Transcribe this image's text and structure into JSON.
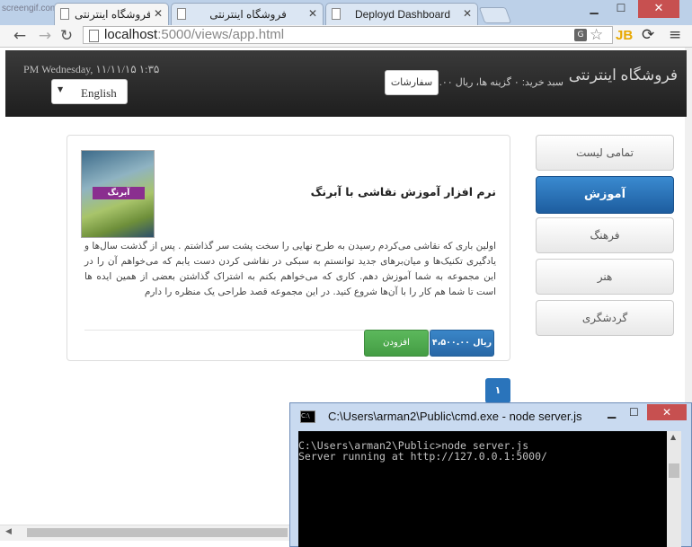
{
  "watermark": "screengif.com",
  "browser": {
    "tabs": [
      {
        "title": "فروشگاه اینترنتی"
      },
      {
        "title": "فروشگاه اینترنتی"
      },
      {
        "title": "Deployd Dashboard"
      }
    ],
    "url_host": "localhost",
    "url_rest": ":5000/views/app.html",
    "ext_label": "JB",
    "icons": [
      "back-icon",
      "forward-icon",
      "reload-icon",
      "page-icon",
      "translate-icon",
      "star-icon",
      "extension-icon",
      "sync-icon",
      "menu-icon"
    ]
  },
  "navbar": {
    "brand": "فروشگاه اینترنتی",
    "cart_text": "سبد خرید: ۰ گزینه ها، ریال ۰.۰۰",
    "orders_label": "سفارشات",
    "datetime": "PM Wednesday, ۱۱/۱۱/۱۵ ۱:۳۵",
    "language": "English"
  },
  "sidebar": {
    "items": [
      {
        "label": "تمامی لیست",
        "active": false
      },
      {
        "label": "آموزش",
        "active": true
      },
      {
        "label": "فرهنگ",
        "active": false
      },
      {
        "label": "هنر",
        "active": false
      },
      {
        "label": "گردشگری",
        "active": false
      }
    ]
  },
  "product": {
    "title": "نرم افزار آموزش نقاشی با آبرنگ",
    "cover_text": "آبرنگ",
    "description": "اولین باری که نقاشی می‌کردم رسیدن به طرح نهایی را سخت پشت سر گذاشتم . پس از گذشت سال‌ها و یادگیری تکنیک‌ها و میان‌برهای جدید توانستم به سبکی در نقاشی کردن دست یابم که می‌خواهم آن را در این مجموعه به شما آموزش دهم. کاری که می‌خواهم بکنم به اشتراک گذاشتن بعضی از همین ایده ها است تا شما هم کار را با آن‌ها شروع کنید. در این مجموعه قصد طراحی یک منظره را دارم",
    "price_label": "ریال ۴،۵۰۰.۰۰",
    "add_label": "افزودن"
  },
  "pagination": {
    "current": "۱"
  },
  "cmd_window": {
    "title": "C:\\Users\\arman2\\Public\\cmd.exe - node  server.js",
    "lines": [
      "C:\\Users\\arman2\\Public>node server.js",
      "Server running at http://127.0.0.1:5000/"
    ]
  },
  "colors": {
    "primary": "#2a74bb",
    "success": "#4cae4c",
    "navbar": "#2b2b2b"
  }
}
